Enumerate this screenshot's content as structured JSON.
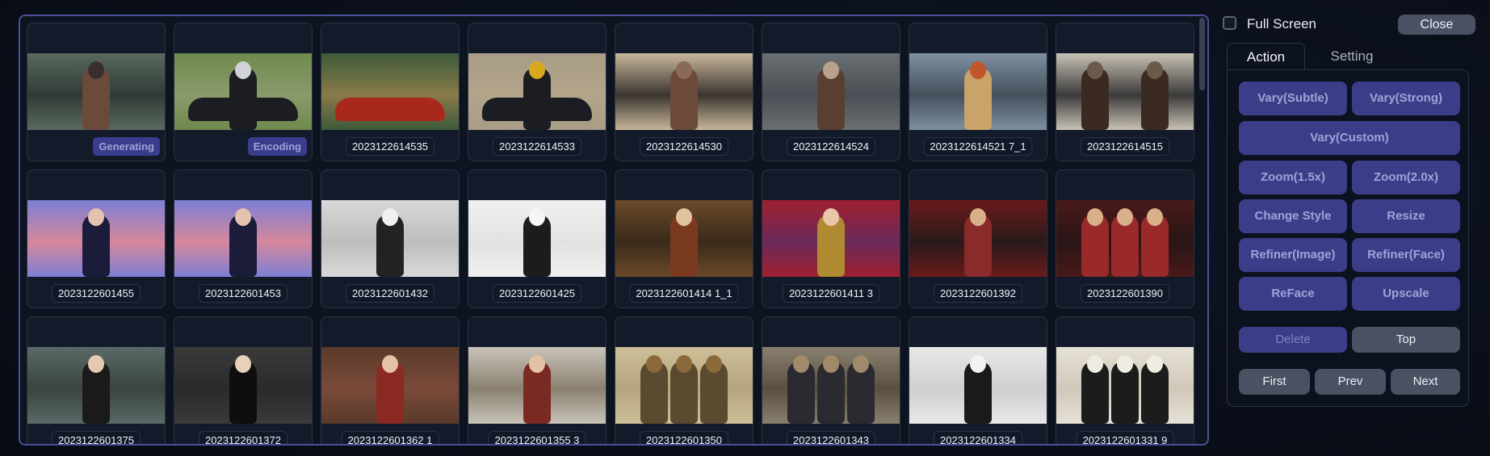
{
  "gallery": {
    "items": [
      {
        "label": "",
        "badge": "Generating",
        "palette": [
          "#5a6a5e",
          "#2f3a35",
          "#6b4a3a",
          "#3a2f2c"
        ],
        "kind": "person-car"
      },
      {
        "label": "",
        "badge": "Encoding",
        "palette": [
          "#6f8a4e",
          "#8a9a6a",
          "#1b1d22",
          "#cfd2d6"
        ],
        "kind": "car-person"
      },
      {
        "label": "2023122614535",
        "badge": "",
        "palette": [
          "#3d5a3a",
          "#8a7a4a",
          "#a8291c",
          "#6a6a6a"
        ],
        "kind": "car"
      },
      {
        "label": "2023122614533",
        "badge": "",
        "palette": [
          "#a99c86",
          "#b3a58a",
          "#1b1d22",
          "#d9a81f"
        ],
        "kind": "car-person"
      },
      {
        "label": "2023122614530",
        "badge": "",
        "palette": [
          "#c9b79b",
          "#3a3530",
          "#6b4a3a",
          "#8a6a56"
        ],
        "kind": "person-car"
      },
      {
        "label": "2023122614524",
        "badge": "",
        "palette": [
          "#6a6f72",
          "#4a4f55",
          "#5a3f30",
          "#b7a28e"
        ],
        "kind": "person"
      },
      {
        "label": "2023122614521 7_1",
        "badge": "",
        "palette": [
          "#7f90a0",
          "#44505c",
          "#c9a36a",
          "#c0562c"
        ],
        "kind": "person"
      },
      {
        "label": "2023122614515",
        "badge": "",
        "palette": [
          "#c9c2b5",
          "#3a3a3a",
          "#3b2a22",
          "#6b5a4a"
        ],
        "kind": "two"
      },
      {
        "label": "2023122601455",
        "badge": "",
        "palette": [
          "#7d7fd4",
          "#d6879c",
          "#1b1c3a",
          "#e3c2b0"
        ],
        "kind": "person"
      },
      {
        "label": "2023122601453",
        "badge": "",
        "palette": [
          "#7d7fd4",
          "#d6879c",
          "#1b1c3a",
          "#e3c2b0"
        ],
        "kind": "person"
      },
      {
        "label": "2023122601432",
        "badge": "",
        "palette": [
          "#d9d9d9",
          "#bdbdbd",
          "#222222",
          "#f0f0f0"
        ],
        "kind": "person"
      },
      {
        "label": "2023122601425",
        "badge": "",
        "palette": [
          "#f0f0f0",
          "#e2e2e2",
          "#1c1c1c",
          "#f5f5f5"
        ],
        "kind": "person"
      },
      {
        "label": "2023122601414 1_1",
        "badge": "",
        "palette": [
          "#6a4a2a",
          "#3a2a1a",
          "#7a3a20",
          "#e2c3a0"
        ],
        "kind": "person"
      },
      {
        "label": "2023122601411 3",
        "badge": "",
        "palette": [
          "#a02030",
          "#6a2a5a",
          "#b08a30",
          "#e8c7a8"
        ],
        "kind": "person"
      },
      {
        "label": "2023122601392",
        "badge": "",
        "palette": [
          "#6a1a1a",
          "#2a1a1a",
          "#8a2a2a",
          "#d9b08a"
        ],
        "kind": "person"
      },
      {
        "label": "2023122601390",
        "badge": "",
        "palette": [
          "#4a1a1a",
          "#2a1515",
          "#9a2a2a",
          "#d9b08a"
        ],
        "kind": "three"
      },
      {
        "label": "2023122601375",
        "badge": "",
        "palette": [
          "#5a6a66",
          "#3a4440",
          "#1a1a1a",
          "#e3c9b0"
        ],
        "kind": "person"
      },
      {
        "label": "2023122601372",
        "badge": "",
        "palette": [
          "#3a3a3a",
          "#2a2a2a",
          "#0e0e0e",
          "#e8d0ba"
        ],
        "kind": "person"
      },
      {
        "label": "2023122601362 1",
        "badge": "",
        "palette": [
          "#5a3a2a",
          "#7a4a3a",
          "#8a2a22",
          "#e3c2a5"
        ],
        "kind": "person"
      },
      {
        "label": "2023122601355 3",
        "badge": "",
        "palette": [
          "#c9c4b8",
          "#8a8070",
          "#7a2a22",
          "#e3c2a5"
        ],
        "kind": "person"
      },
      {
        "label": "2023122601350",
        "badge": "",
        "palette": [
          "#cdbf98",
          "#b5a57e",
          "#5a4a30",
          "#8a6a3a"
        ],
        "kind": "three"
      },
      {
        "label": "2023122601343",
        "badge": "",
        "palette": [
          "#8a8070",
          "#5a5040",
          "#2a2a30",
          "#a08a6a"
        ],
        "kind": "three"
      },
      {
        "label": "2023122601334",
        "badge": "",
        "palette": [
          "#e8e8e8",
          "#cfcfcf",
          "#1a1a1a",
          "#f2f2f2"
        ],
        "kind": "person"
      },
      {
        "label": "2023122601331 9",
        "badge": "",
        "palette": [
          "#e6e1d6",
          "#d0c8b8",
          "#1c1c1c",
          "#f0ece2"
        ],
        "kind": "three"
      }
    ]
  },
  "topbar": {
    "fullscreen_label": "Full Screen",
    "close_label": "Close"
  },
  "tabs": {
    "action": "Action",
    "setting": "Setting"
  },
  "actions": {
    "vary_subtle": "Vary(Subtle)",
    "vary_strong": "Vary(Strong)",
    "vary_custom": "Vary(Custom)",
    "zoom_15": "Zoom(1.5x)",
    "zoom_20": "Zoom(2.0x)",
    "change_style": "Change Style",
    "resize": "Resize",
    "refiner_image": "Refiner(Image)",
    "refiner_face": "Refiner(Face)",
    "reface": "ReFace",
    "upscale": "Upscale",
    "delete": "Delete",
    "top": "Top",
    "first": "First",
    "prev": "Prev",
    "next": "Next"
  }
}
